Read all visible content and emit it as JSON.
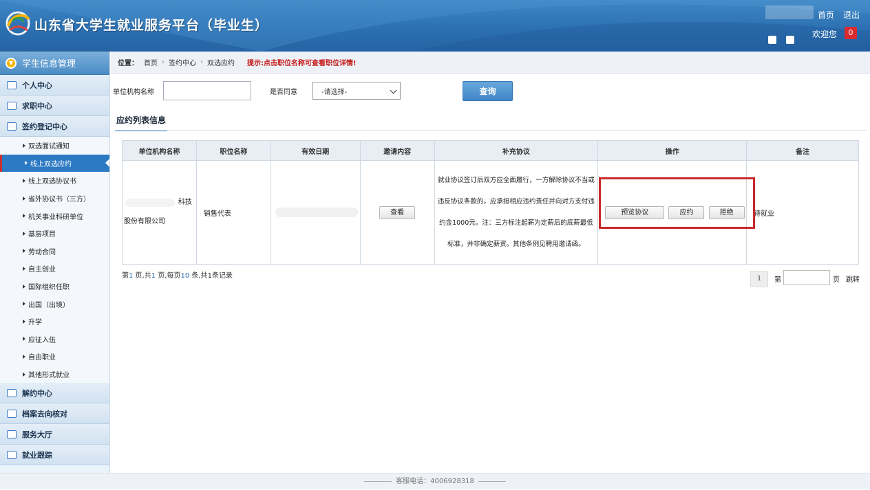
{
  "header": {
    "title": "山东省大学生就业服务平台（毕业生）",
    "home_link": "首页",
    "logout_link": "退出",
    "welcome": "欢迎您",
    "badge_count": "0"
  },
  "sidebar": {
    "section_title": "学生信息管理",
    "groups_top": [
      {
        "label": "个人中心",
        "icon": "document-icon"
      },
      {
        "label": "求职中心",
        "icon": "chat-icon"
      },
      {
        "label": "签约登记中心",
        "icon": "edit-icon"
      }
    ],
    "subitems": [
      {
        "label": "双选面试通知",
        "active": false
      },
      {
        "label": "线上双选应约",
        "active": true
      },
      {
        "label": "线上双选协议书",
        "active": false
      },
      {
        "label": "省外协议书（三方）",
        "active": false
      },
      {
        "label": "机关事业科研单位",
        "active": false
      },
      {
        "label": "基层项目",
        "active": false
      },
      {
        "label": "劳动合同",
        "active": false
      },
      {
        "label": "自主创业",
        "active": false
      },
      {
        "label": "国际组织任职",
        "active": false
      },
      {
        "label": "出国（出境）",
        "active": false
      },
      {
        "label": "升学",
        "active": false
      },
      {
        "label": "应征入伍",
        "active": false
      },
      {
        "label": "自由职业",
        "active": false
      },
      {
        "label": "其他形式就业",
        "active": false
      }
    ],
    "groups_bottom": [
      {
        "label": "解约中心",
        "icon": "calendar-icon"
      },
      {
        "label": "档案去向核对",
        "icon": "document-icon"
      },
      {
        "label": "服务大厅",
        "icon": "chat-icon"
      },
      {
        "label": "就业跟踪",
        "icon": "edit-icon"
      }
    ]
  },
  "breadcrumb": {
    "label": "位置：",
    "items": [
      "首页",
      "签约中心",
      "双选应约"
    ],
    "tip": "提示:点击职位名称可查看职位详情!"
  },
  "filter": {
    "org_label": "单位机构名称",
    "org_value": "",
    "agree_label": "是否同意",
    "agree_selected": "-请选择-",
    "query_button": "查询"
  },
  "section_title": "应约列表信息",
  "table": {
    "headers": [
      "单位机构名称",
      "职位名称",
      "有效日期",
      "邀请内容",
      "补充协议",
      "操作",
      "备注"
    ],
    "rows": [
      {
        "org_suffix": "科技",
        "org_line2": "股份有限公司",
        "position": "销售代表",
        "date": "",
        "view_button": "查看",
        "agreement": "就业协议签订后双方应全面履行，一方解除协议不当或违反协议条款的，应承担相应违约责任并向对方支付违约金1000元。注：三方标注起薪为定薪后的底薪最低标准，并非确定薪资。其他条例见聘用邀请函。",
        "preview_button": "预览协议",
        "accept_button": "应约",
        "reject_button": "拒绝",
        "remark": "待就业"
      }
    ]
  },
  "pager": {
    "p1": "第",
    "page": "1",
    "p2": " 页,共",
    "total_pages": "1",
    "p3": " 页,每页",
    "per_page": "10",
    "p4": " 条,共",
    "total_records": "1",
    "p5": "条记录",
    "current_page": "1",
    "di": "第",
    "ye": "页",
    "go": "跳转"
  },
  "footer": {
    "text": "客服电话：4006928318"
  }
}
